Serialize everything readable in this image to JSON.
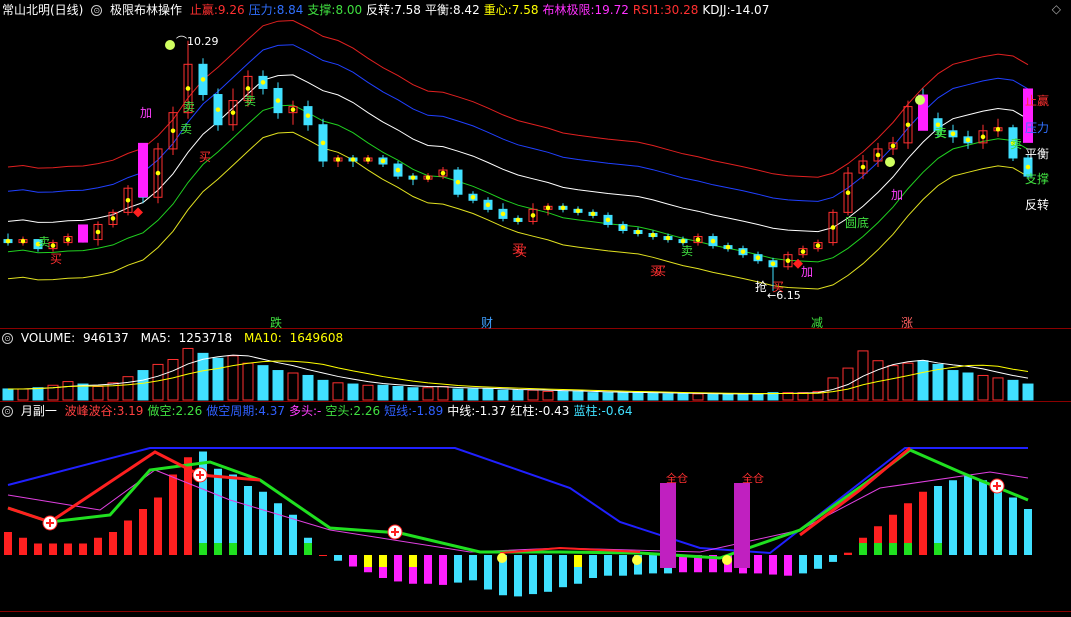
{
  "main_header": {
    "stock": "常山北明(日线)",
    "indicator": "极限布林操作",
    "items": [
      {
        "label": "止赢:",
        "value": "9.26",
        "color": "#ff3030"
      },
      {
        "label": "压力:",
        "value": "8.84",
        "color": "#3070ff"
      },
      {
        "label": "支撑:",
        "value": "8.00",
        "color": "#40e040"
      },
      {
        "label": "反转:",
        "value": "7.58",
        "color": "#ffffff"
      },
      {
        "label": "平衡:",
        "value": "8.42",
        "color": "#ffffff"
      },
      {
        "label": "重心:",
        "value": "7.58",
        "color": "#ffff00"
      },
      {
        "label": "布林极限:",
        "value": "19.72",
        "color": "#ff30ff"
      },
      {
        "label": "RSI1:",
        "value": "30.28",
        "color": "#ff3030"
      },
      {
        "label": "KDJJ:",
        "value": "-14.07",
        "color": "#ffffff"
      }
    ]
  },
  "main_chart": {
    "high_label": "10.29",
    "low_label": "6.15",
    "right_labels": [
      {
        "text": "止赢",
        "color": "#ff3030"
      },
      {
        "text": "压力",
        "color": "#3070ff"
      },
      {
        "text": "平衡",
        "color": "#ffffff"
      },
      {
        "text": "支撑",
        "color": "#40e040"
      },
      {
        "text": "反转",
        "color": "#ffffff"
      }
    ],
    "signals": [
      {
        "text": "加",
        "color": "#ff40ff"
      },
      {
        "text": "卖",
        "color": "#40e040"
      },
      {
        "text": "买",
        "color": "#ff3030"
      },
      {
        "text": "卖",
        "color": "#40e040"
      },
      {
        "text": "买",
        "color": "#ff3030"
      },
      {
        "text": "卖",
        "color": "#40e040"
      },
      {
        "text": "买",
        "color": "#ff3030"
      },
      {
        "text": "卖",
        "color": "#40e040"
      },
      {
        "text": "买",
        "color": "#ff3030"
      },
      {
        "text": "卖",
        "color": "#40e040"
      },
      {
        "text": "抢",
        "color": "#ffffff"
      },
      {
        "text": "买",
        "color": "#ff3030"
      },
      {
        "text": "加",
        "color": "#ff40ff"
      },
      {
        "text": "圆底",
        "color": "#40e040"
      },
      {
        "text": "加",
        "color": "#ff40ff"
      },
      {
        "text": "卖",
        "color": "#40e040"
      },
      {
        "text": "卖",
        "color": "#40e040"
      },
      {
        "text": "卖",
        "color": "#40e040"
      },
      {
        "text": "买",
        "color": "#ff3030"
      },
      {
        "text": "买",
        "color": "#ff3030"
      }
    ],
    "bottom_words": [
      {
        "text": "跌",
        "color": "#40e040"
      },
      {
        "text": "财",
        "color": "#40a0ff"
      },
      {
        "text": "减",
        "color": "#40e040"
      },
      {
        "text": "涨",
        "color": "#ff6060"
      }
    ]
  },
  "volume_header": {
    "volume_label": "VOLUME:",
    "volume_value": "946137",
    "ma5_label": "MA5:",
    "ma5_value": "1253718",
    "ma10_label": "MA10:",
    "ma10_value": "1649608"
  },
  "sub_header": {
    "name": "月副一",
    "items": [
      {
        "label": "波峰波谷:",
        "value": "3.19",
        "color": "#ff4040"
      },
      {
        "label": "做空:",
        "value": "2.26",
        "color": "#40e040"
      },
      {
        "label": "做空周期:",
        "value": "4.37",
        "color": "#3060ff"
      },
      {
        "label": "多头:",
        "value": "-",
        "color": "#ff40ff"
      },
      {
        "label": "空头:",
        "value": "2.26",
        "color": "#40e040"
      },
      {
        "label": "短线:",
        "value": "-1.89",
        "color": "#3060ff"
      },
      {
        "label": "中线:",
        "value": "-1.37",
        "color": "#ffffff"
      },
      {
        "label": "红柱:",
        "value": "-0.43",
        "color": "#ffffff"
      },
      {
        "label": "蓝柱:",
        "value": "-0.64",
        "color": "#40e0ff"
      }
    ],
    "full_pos_label": "全仓"
  },
  "chart_data": [
    {
      "type": "candlestick",
      "title": "常山北明(日线) 极限布林操作",
      "annotations": [
        "10.29",
        "6.15"
      ],
      "ohlc": [
        [
          7.0,
          7.1,
          6.9,
          6.95
        ],
        [
          6.95,
          7.05,
          6.9,
          7.0
        ],
        [
          7.0,
          7.0,
          6.8,
          6.85
        ],
        [
          6.85,
          7.0,
          6.8,
          6.95
        ],
        [
          6.95,
          7.1,
          6.9,
          7.05
        ],
        [
          7.05,
          7.2,
          6.95,
          7.0
        ],
        [
          7.0,
          7.3,
          6.9,
          7.25
        ],
        [
          7.25,
          7.5,
          7.2,
          7.45
        ],
        [
          7.45,
          7.9,
          7.4,
          7.85
        ],
        [
          7.85,
          8.0,
          7.6,
          7.7
        ],
        [
          7.7,
          8.6,
          7.6,
          8.5
        ],
        [
          8.5,
          9.2,
          8.4,
          9.1
        ],
        [
          9.1,
          10.29,
          9.0,
          9.9
        ],
        [
          9.9,
          10.0,
          9.3,
          9.4
        ],
        [
          9.4,
          9.5,
          8.8,
          8.9
        ],
        [
          8.9,
          9.5,
          8.8,
          9.3
        ],
        [
          9.3,
          9.8,
          9.2,
          9.7
        ],
        [
          9.7,
          9.8,
          9.4,
          9.5
        ],
        [
          9.5,
          9.6,
          9.0,
          9.1
        ],
        [
          9.1,
          9.3,
          8.9,
          9.2
        ],
        [
          9.2,
          9.3,
          8.8,
          8.9
        ],
        [
          8.9,
          9.0,
          8.2,
          8.3
        ],
        [
          8.3,
          8.4,
          8.2,
          8.35
        ],
        [
          8.35,
          8.4,
          8.2,
          8.3
        ],
        [
          8.3,
          8.4,
          8.25,
          8.35
        ],
        [
          8.35,
          8.4,
          8.2,
          8.25
        ],
        [
          8.25,
          8.3,
          8.0,
          8.05
        ],
        [
          8.05,
          8.1,
          7.9,
          8.0
        ],
        [
          8.0,
          8.1,
          7.95,
          8.05
        ],
        [
          8.05,
          8.2,
          8.0,
          8.15
        ],
        [
          8.15,
          8.2,
          7.7,
          7.75
        ],
        [
          7.75,
          7.8,
          7.6,
          7.65
        ],
        [
          7.65,
          7.7,
          7.45,
          7.5
        ],
        [
          7.5,
          7.6,
          7.3,
          7.35
        ],
        [
          7.35,
          7.4,
          7.25,
          7.3
        ],
        [
          7.3,
          7.6,
          7.25,
          7.5
        ],
        [
          7.5,
          7.6,
          7.4,
          7.55
        ],
        [
          7.55,
          7.6,
          7.45,
          7.5
        ],
        [
          7.5,
          7.55,
          7.4,
          7.45
        ],
        [
          7.45,
          7.5,
          7.35,
          7.4
        ],
        [
          7.4,
          7.45,
          7.2,
          7.25
        ],
        [
          7.25,
          7.3,
          7.1,
          7.15
        ],
        [
          7.15,
          7.2,
          7.05,
          7.1
        ],
        [
          7.1,
          7.15,
          7.0,
          7.05
        ],
        [
          7.05,
          7.1,
          6.95,
          7.0
        ],
        [
          7.0,
          7.05,
          6.9,
          6.95
        ],
        [
          6.95,
          7.1,
          6.9,
          7.05
        ],
        [
          7.05,
          7.1,
          6.85,
          6.9
        ],
        [
          6.9,
          6.95,
          6.8,
          6.85
        ],
        [
          6.85,
          6.9,
          6.7,
          6.75
        ],
        [
          6.75,
          6.8,
          6.6,
          6.65
        ],
        [
          6.65,
          6.7,
          6.15,
          6.55
        ],
        [
          6.55,
          6.8,
          6.5,
          6.75
        ],
        [
          6.75,
          6.9,
          6.7,
          6.85
        ],
        [
          6.85,
          7.0,
          6.8,
          6.95
        ],
        [
          6.95,
          7.5,
          6.9,
          7.45
        ],
        [
          7.45,
          8.2,
          7.4,
          8.1
        ],
        [
          8.1,
          8.4,
          8.0,
          8.3
        ],
        [
          8.3,
          8.6,
          8.2,
          8.5
        ],
        [
          8.5,
          8.7,
          8.4,
          8.6
        ],
        [
          8.6,
          9.3,
          8.5,
          9.2
        ],
        [
          9.2,
          9.5,
          8.9,
          9.0
        ],
        [
          9.0,
          9.1,
          8.7,
          8.8
        ],
        [
          8.8,
          8.9,
          8.6,
          8.7
        ],
        [
          8.7,
          8.8,
          8.5,
          8.6
        ],
        [
          8.6,
          8.9,
          8.5,
          8.8
        ],
        [
          8.8,
          9.0,
          8.7,
          8.85
        ],
        [
          8.85,
          8.9,
          8.3,
          8.35
        ],
        [
          8.35,
          8.4,
          8.0,
          8.05
        ]
      ]
    },
    {
      "type": "bar",
      "title": "VOLUME",
      "series": [
        {
          "name": "VOLUME",
          "values": [
            0.9,
            0.9,
            1.0,
            1.2,
            1.5,
            1.3,
            1.1,
            1.4,
            1.9,
            2.4,
            2.9,
            3.3,
            4.2,
            3.8,
            3.4,
            3.6,
            3.0,
            2.8,
            2.4,
            2.2,
            2.0,
            1.6,
            1.4,
            1.3,
            1.2,
            1.2,
            1.1,
            1.0,
            1.0,
            1.1,
            0.9,
            0.9,
            0.9,
            0.8,
            0.8,
            0.8,
            0.7,
            0.7,
            0.7,
            0.6,
            0.6,
            0.6,
            0.6,
            0.6,
            0.5,
            0.5,
            0.5,
            0.5,
            0.5,
            0.5,
            0.5,
            0.6,
            0.6,
            0.6,
            0.7,
            1.8,
            2.6,
            4.0,
            3.2,
            2.8,
            3.0,
            3.2,
            2.9,
            2.4,
            2.2,
            2.0,
            1.8,
            1.6,
            1.3
          ]
        }
      ]
    },
    {
      "type": "bar",
      "title": "月副一",
      "series": [
        {
          "name": "波峰波谷",
          "values": [
            2.0,
            1.5,
            1.0,
            1.0,
            1.0,
            1.0,
            1.5,
            2.0,
            3.0,
            4.0,
            5.0,
            7.0,
            8.5,
            9.0,
            7.5,
            7.0,
            6.0,
            5.5,
            4.5,
            3.5,
            1.5,
            0.0,
            -0.5,
            -1.0,
            -1.5,
            -2.0,
            -2.3,
            -2.5,
            -2.5,
            -2.6,
            -2.4,
            -2.2,
            -3.0,
            -3.5,
            -3.6,
            -3.4,
            -3.2,
            -2.8,
            -2.5,
            -2.0,
            -1.8,
            -1.8,
            -1.7,
            -1.6,
            -1.6,
            -1.5,
            -1.5,
            -1.5,
            -1.5,
            -1.6,
            -1.6,
            -1.7,
            -1.8,
            -1.6,
            -1.2,
            -0.6,
            0.2,
            1.5,
            2.5,
            3.5,
            4.5,
            5.5,
            6.0,
            6.5,
            7.0,
            6.5,
            6.0,
            5.0,
            4.0
          ]
        }
      ]
    }
  ]
}
